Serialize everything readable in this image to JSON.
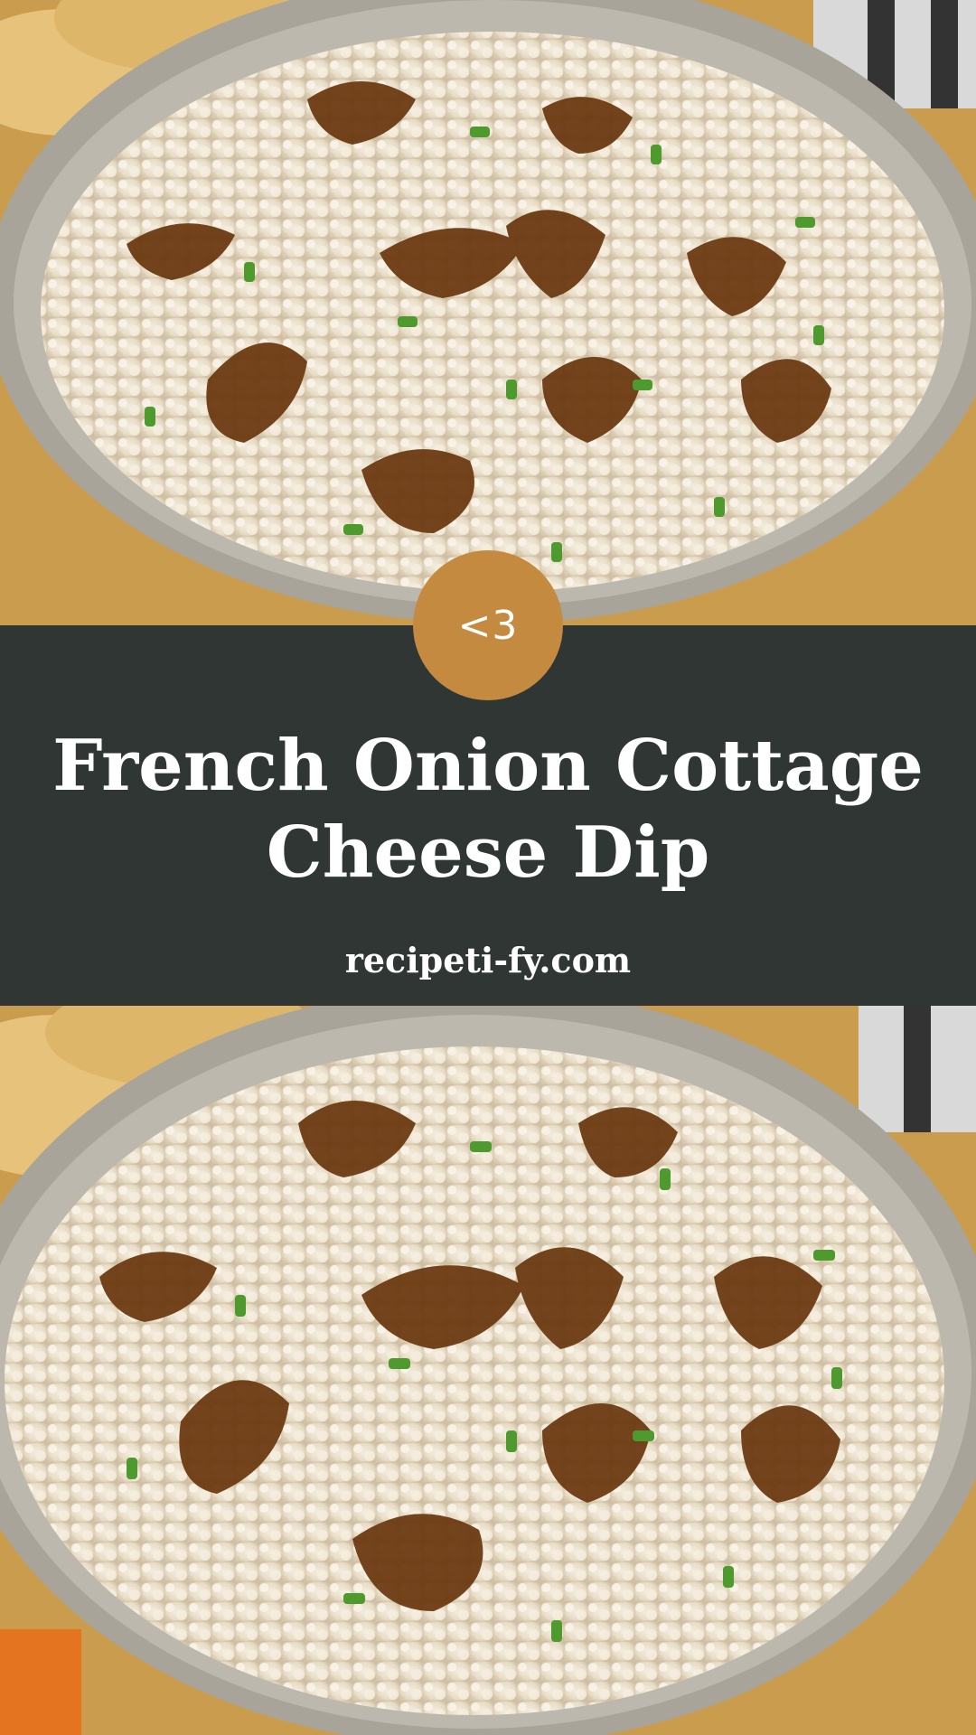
{
  "badge": {
    "text": "<3",
    "icon": "chevron-left-heart"
  },
  "title": {
    "line1": "French Onion Cottage",
    "line2": "Cheese Dip"
  },
  "site": {
    "text": "recipeti-fy.com"
  },
  "colors": {
    "band": "#2f3634",
    "badge": "#c48a3f",
    "text": "#ffffff",
    "dip": "#ece3d2",
    "onion": "#6b3a12",
    "chive": "#4f9a2e",
    "bowl": "#b8b4ab"
  }
}
